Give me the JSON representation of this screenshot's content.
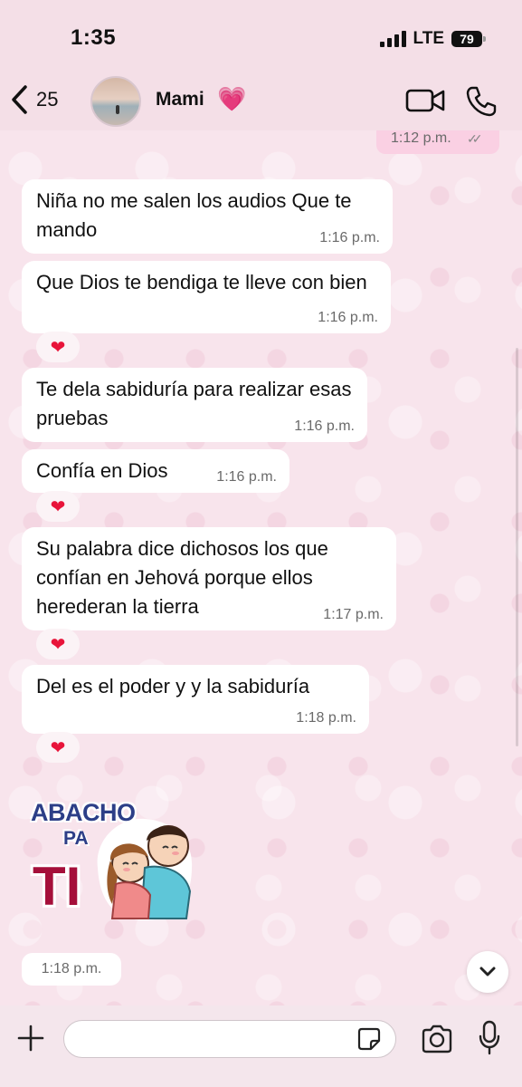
{
  "status_bar": {
    "time": "1:35",
    "network": "LTE",
    "battery": "79"
  },
  "header": {
    "back_count": "25",
    "contact_name": "Mami",
    "contact_emoji": "💗"
  },
  "chat": {
    "outgoing_top": {
      "time": "1:12 p.m.",
      "status": "read"
    },
    "messages": [
      {
        "text": "Niña no me salen los audios Que te mando",
        "time": "1:16 p.m.",
        "reaction": null
      },
      {
        "text": "Que Dios te bendiga te lleve con bien",
        "time": "1:16 p.m.",
        "reaction": "❤"
      },
      {
        "text": "Te dela sabiduría para realizar esas pruebas",
        "time": "1:16 p.m.",
        "reaction": null
      },
      {
        "text": "Confía en Dios",
        "time": "1:16 p.m.",
        "reaction": "❤"
      },
      {
        "text": "Su palabra dice dichosos los que confían en Jehová porque ellos herederan la tierra",
        "time": "1:17 p.m.",
        "reaction": "❤"
      },
      {
        "text": "Del es el poder y y la sabiduría",
        "time": "1:18 p.m.",
        "reaction": "❤"
      }
    ],
    "sticker": {
      "line1": "ABACHO",
      "line2": "PA",
      "line3": "TI",
      "time": "1:18 p.m."
    }
  },
  "icons": {
    "back": "chevron-left-icon",
    "video": "video-camera-icon",
    "phone": "phone-icon",
    "plus": "plus-icon",
    "sticker": "sticker-icon",
    "camera": "camera-icon",
    "mic": "microphone-icon",
    "scroll": "chevron-down-icon"
  },
  "colors": {
    "incoming_bubble": "#ffffff",
    "outgoing_bubble": "#fad0e3",
    "background": "#f8e4ec",
    "reaction_heart": "#e8143a"
  }
}
